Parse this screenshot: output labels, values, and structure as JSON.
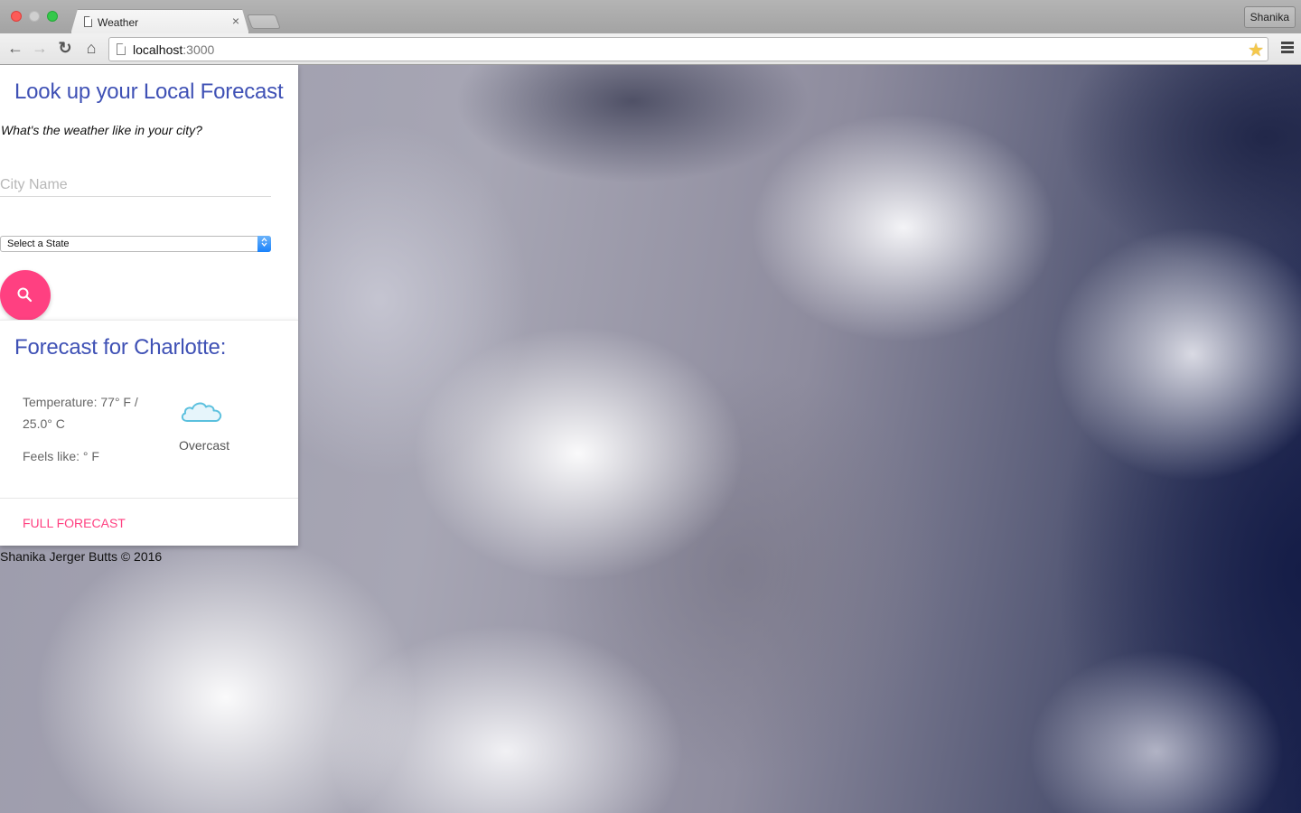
{
  "browser": {
    "tab_title": "Weather",
    "tab_close": "×",
    "url_host": "localhost",
    "url_port": ":3000",
    "profile_name": "Shanika",
    "icons": {
      "back": "←",
      "forward": "→",
      "reload": "↻",
      "home": "⌂",
      "star": "★"
    }
  },
  "search_card": {
    "title": "Look up your Local Forecast",
    "subtitle": "What's the weather like in your city?",
    "city_input": {
      "placeholder": "City Name",
      "value": ""
    },
    "state_select": {
      "selected": "Select a State",
      "arrows": "⌃⌄"
    },
    "search_button_icon": "search-icon"
  },
  "forecast_card": {
    "title": "Forecast for Charlotte:",
    "temperature": "Temperature: 77° F / 25.0° C",
    "feels_like": "Feels like: ° F",
    "condition": "Overcast",
    "condition_icon": "cloud-icon",
    "icon_color": "#5bc0de",
    "link_label": "Full Forecast"
  },
  "footer": {
    "text": "Shanika Jerger Butts © 2016"
  },
  "colors": {
    "title_blue": "#3f51b5",
    "accent_pink": "#ff4081"
  }
}
